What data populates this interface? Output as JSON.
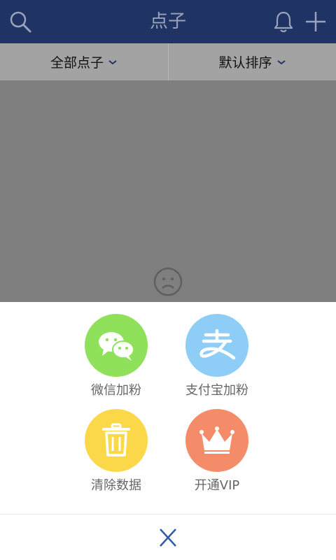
{
  "header": {
    "title": "点子",
    "search_icon": "search-icon",
    "bell_icon": "bell-icon",
    "add_icon": "plus-icon",
    "background_color": "#1f3364"
  },
  "filters": {
    "left_label": "全部点子",
    "right_label": "默认排序",
    "chevron_color": "#1f3364"
  },
  "empty_state": {
    "icon": "sad-face-icon"
  },
  "share_sheet": {
    "items": [
      {
        "label": "微信加粉",
        "icon": "wechat-icon",
        "color": "#8fe05b"
      },
      {
        "label": "支付宝加粉",
        "icon": "alipay-icon",
        "color": "#8ecdf5"
      },
      {
        "label": "清除数据",
        "icon": "trash-icon",
        "color": "#fbd84a"
      },
      {
        "label": "开通VIP",
        "icon": "crown-icon",
        "color": "#f58c69"
      }
    ],
    "close_icon": "close-icon"
  }
}
